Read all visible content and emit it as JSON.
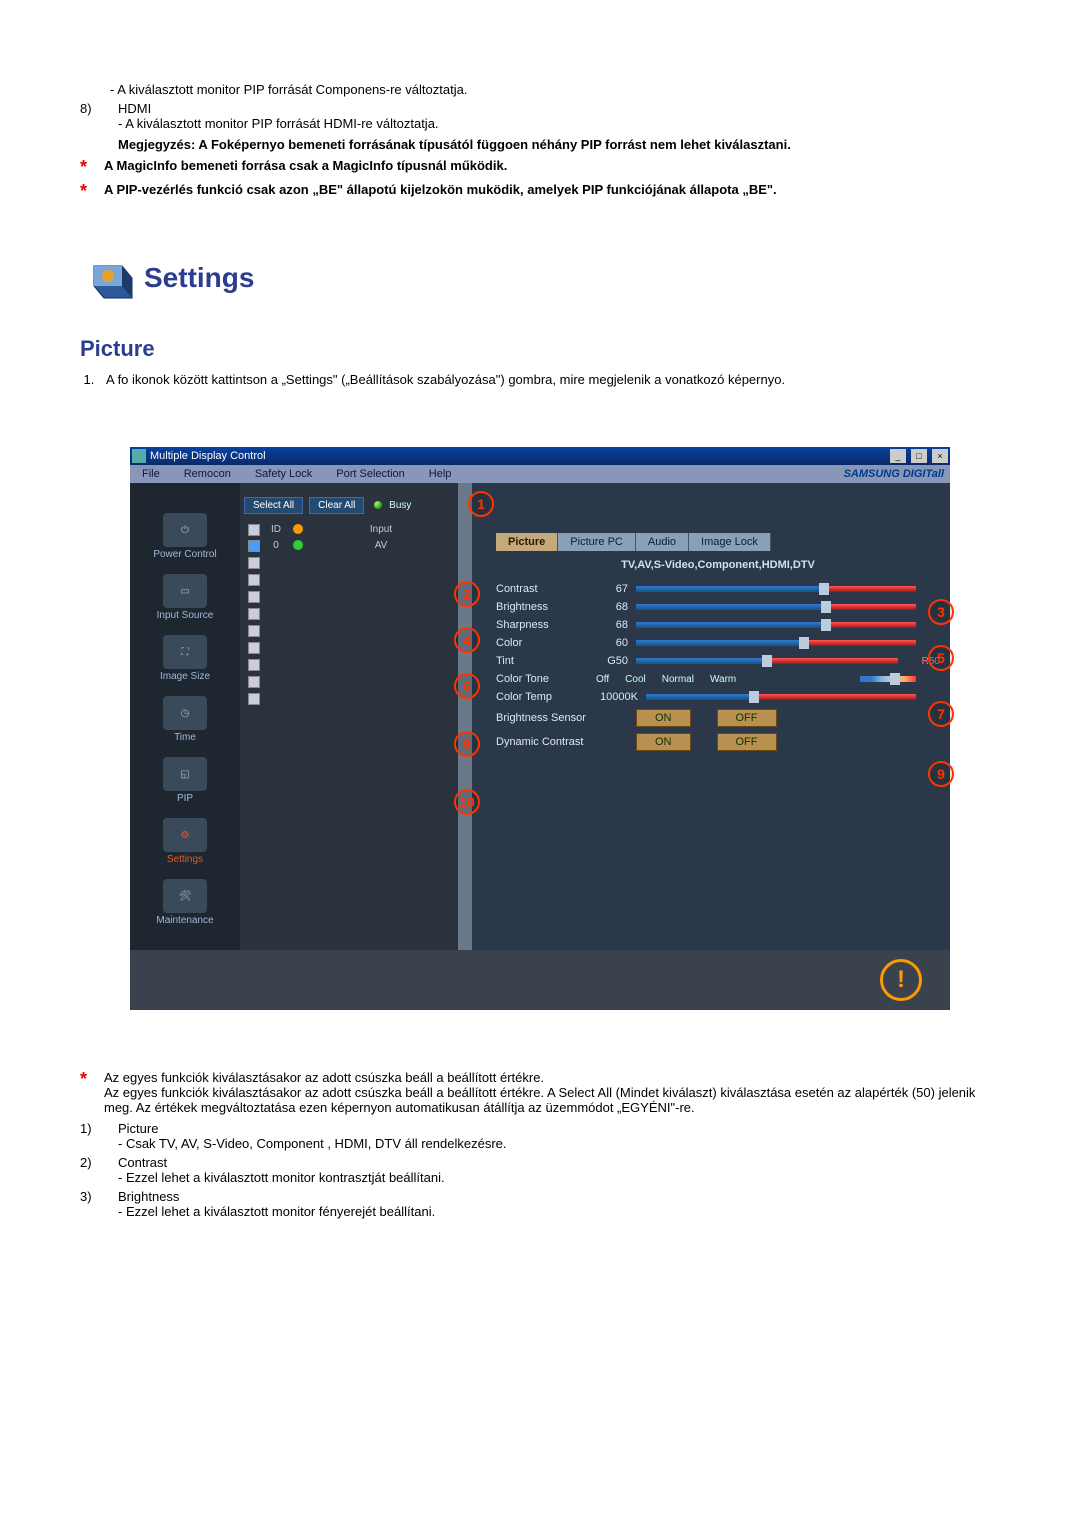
{
  "intro": {
    "item8_sub": "- A kiválasztott monitor PIP forrását Componens-re változtatja.",
    "item8_num": "8)",
    "item8_label": "HDMI",
    "item8_body": "- A kiválasztott monitor PIP forrását HDMI-re változtatja.",
    "note_bold": "Megjegyzés: A Foképernyo bemeneti forrásának típusától függoen néhány PIP forrást nem lehet kiválasztani.",
    "star1": "A MagicInfo bemeneti forrása csak a MagicInfo típusnál működik.",
    "star2": "A PIP-vezérlés funkció csak azon „BE\" állapotú kijelzokön muködik, amelyek PIP funkciójának állapota „BE\"."
  },
  "settings_heading": "Settings",
  "picture_heading": "Picture",
  "picture_step1": "A fo ikonok között kattintson a „Settings\" („Beállítások szabályozása\") gombra, mire megjelenik a vonatkozó képernyo.",
  "window": {
    "title": "Multiple Display Control",
    "menus": [
      "File",
      "Remocon",
      "Safety Lock",
      "Port Selection",
      "Help"
    ],
    "brand": "SAMSUNG DIGITall",
    "sidebar": [
      {
        "label": "Power Control"
      },
      {
        "label": "Input Source"
      },
      {
        "label": "Image Size"
      },
      {
        "label": "Time"
      },
      {
        "label": "PIP"
      },
      {
        "label": "Settings",
        "active": true
      },
      {
        "label": "Maintenance"
      }
    ],
    "mid": {
      "select_all": "Select All",
      "clear_all": "Clear All",
      "busy": "Busy",
      "head_id": "ID",
      "head_input": "Input",
      "rows": [
        {
          "checked": true,
          "id": "0",
          "status": "green",
          "input": "AV"
        }
      ],
      "blank_rows": 9
    },
    "tabs": [
      {
        "label": "Picture",
        "active": true
      },
      {
        "label": "Picture PC"
      },
      {
        "label": "Audio"
      },
      {
        "label": "Image Lock"
      }
    ],
    "modes": "TV,AV,S-Video,Component,HDMI,DTV",
    "controls": [
      {
        "label": "Contrast",
        "value": "67",
        "pct": 67
      },
      {
        "label": "Brightness",
        "value": "68",
        "pct": 68
      },
      {
        "label": "Sharpness",
        "value": "68",
        "pct": 68
      },
      {
        "label": "Color",
        "value": "60",
        "pct": 60
      }
    ],
    "tint": {
      "label": "Tint",
      "left": "G50",
      "right": "R50",
      "pct": 50
    },
    "colortone": {
      "label": "Color Tone",
      "opts": [
        "Off",
        "Cool",
        "",
        "Normal",
        "",
        "Warm"
      ],
      "pct": 62
    },
    "colortemp": {
      "label": "Color Temp",
      "value": "10000K",
      "pct": 40
    },
    "brightness_sensor": {
      "label": "Brightness Sensor",
      "on": "ON",
      "off": "OFF"
    },
    "dynamic_contrast": {
      "label": "Dynamic Contrast",
      "on": "ON",
      "off": "OFF"
    },
    "callouts": [
      "1",
      "2",
      "3",
      "4",
      "5",
      "6",
      "7",
      "8",
      "9",
      "10"
    ]
  },
  "footnotes": {
    "star_text1": "Az egyes funkciók kiválasztásakor az adott csúszka beáll a beállított értékre.",
    "star_text2": "Az egyes funkciók kiválasztásakor az adott csúszka beáll a beállított értékre. A Select All (Mindet kiválaszt) kiválasztása esetén az alapérték (50) jelenik meg. Az értékek megváltoztatása ezen képernyon automatikusan átállítja az üzemmódot „EGYÉNI\"-re.",
    "items": [
      {
        "num": "1)",
        "label": "Picture",
        "body": "- Csak TV, AV, S-Video, Component , HDMI, DTV áll rendelkezésre."
      },
      {
        "num": "2)",
        "label": "Contrast",
        "body": "- Ezzel lehet a kiválasztott monitor kontrasztját beállítani."
      },
      {
        "num": "3)",
        "label": "Brightness",
        "body": "- Ezzel lehet a kiválasztott monitor fényerejét beállítani."
      }
    ]
  }
}
